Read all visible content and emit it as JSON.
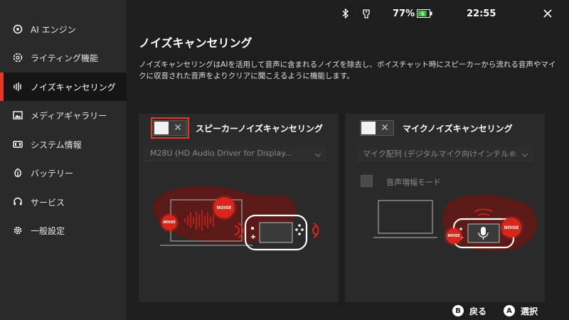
{
  "sidebar": {
    "items": [
      {
        "label": "AI エンジン",
        "icon": "ai-engine-icon"
      },
      {
        "label": "ライティング機能",
        "icon": "lighting-icon"
      },
      {
        "label": "ノイズキャンセリング",
        "icon": "noise-cancel-icon",
        "active": true
      },
      {
        "label": "メディアギャラリー",
        "icon": "gallery-icon"
      },
      {
        "label": "システム情報",
        "icon": "system-info-icon"
      },
      {
        "label": "バッテリー",
        "icon": "battery-leaf-icon"
      },
      {
        "label": "サービス",
        "icon": "headset-icon"
      },
      {
        "label": "一般設定",
        "icon": "gear-icon"
      }
    ]
  },
  "status_bar": {
    "battery_percent": "77%",
    "battery_level": 0.77,
    "time": "22:55"
  },
  "page": {
    "title": "ノイズキャンセリング",
    "description": "ノイズキャンセリングはAIを活用して音声に含まれるノイズを除去し、ボイスチャット時にスピーカーから流れる音声やマイクに収音された音声をよりクリアに聞こえるように機能します。"
  },
  "speaker_panel": {
    "title": "スピーカーノイズキャンセリング",
    "toggle_on": false,
    "device": "M28U (HD Audio Driver for Display...",
    "noise_label": "NOISE"
  },
  "mic_panel": {
    "title": "マイクノイズキャンセリング",
    "toggle_on": false,
    "device": "マイク配列 (デジタルマイク向けインテル®...",
    "boost_label": "音声増幅モード",
    "noise_label": "NOISE"
  },
  "footer": {
    "back_key": "B",
    "back_label": "戻る",
    "select_key": "A",
    "select_label": "選択"
  },
  "colors": {
    "accent": "#e8362a",
    "noise": "#d9251c",
    "battery": "#3fbf3f"
  }
}
